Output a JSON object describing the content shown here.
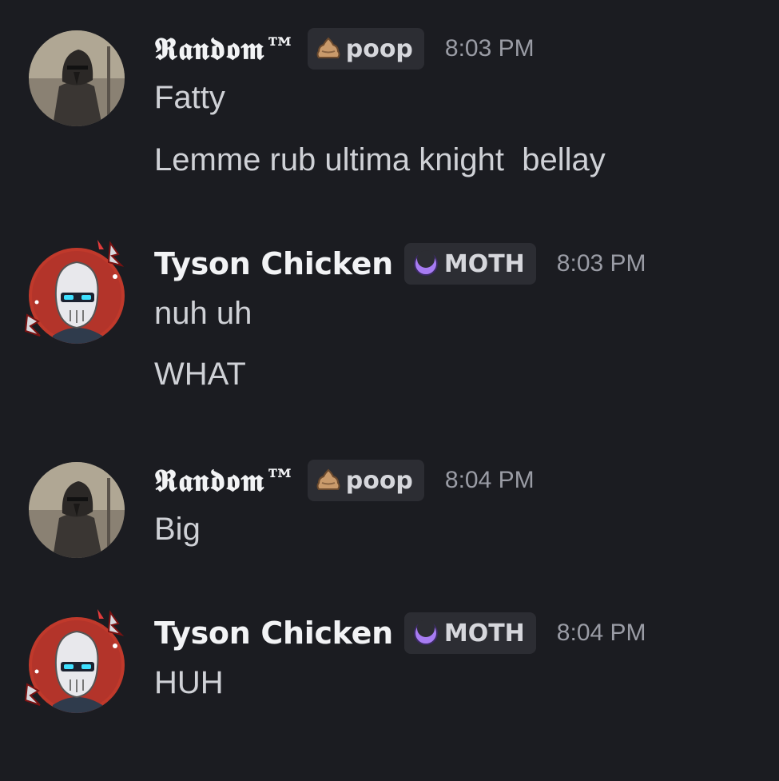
{
  "messages": [
    {
      "author": "𝕽𝖆𝖓𝖉𝖔𝖒™",
      "tag_icon": "poop-icon",
      "tag": "poop",
      "time": "8:03 PM",
      "lines": [
        "Fatty",
        "Lemme rub ultima knight  bellay"
      ]
    },
    {
      "author": "Tyson Chicken",
      "tag_icon": "moon-icon",
      "tag": "MOTH",
      "time": "8:03 PM",
      "lines": [
        "nuh uh",
        "WHAT"
      ]
    },
    {
      "author": "𝕽𝖆𝖓𝖉𝖔𝖒™",
      "tag_icon": "poop-icon",
      "tag": "poop",
      "time": "8:04 PM",
      "lines": [
        "Big"
      ]
    },
    {
      "author": "Tyson Chicken",
      "tag_icon": "moon-icon",
      "tag": "MOTH",
      "time": "8:04 PM",
      "lines": [
        "HUH"
      ]
    }
  ],
  "colors": {
    "background": "#1b1c21",
    "username": "#f2f3f5",
    "message_text": "#cfd1d6",
    "timestamp": "#9a9ca5",
    "tag_bg": "#2c2d33",
    "moth_accent": "#a77cf2",
    "avatar_red": "#c0392b"
  }
}
